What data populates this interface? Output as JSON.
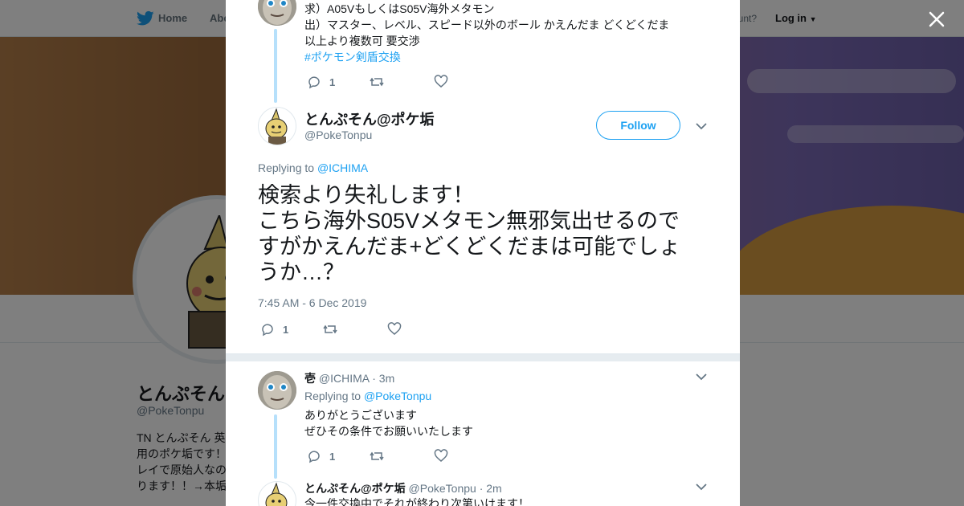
{
  "topnav": {
    "home_label": "Home",
    "about_label": "Abo",
    "account_question": "ccount?",
    "login_label": "Log in"
  },
  "profile": {
    "name": "とんぷそん",
    "handle": "@PokeTonpu",
    "bio": "TN とんぷそん 英\n用のポケ垢です！\nレイで原始人なの\nります！！→本垢"
  },
  "modal": {
    "prev_tweet": {
      "lines": [
        "求）A05VもしくはS05V海外メタモン",
        "出）マスター、レベル、スピード以外のボール かえんだま どくどくだま",
        "以上より複数可 要交渉"
      ],
      "hashtag": "#ポケモン剣盾交換",
      "reply_count": "1"
    },
    "main_tweet": {
      "display_name": "とんぷそん@ポケ垢",
      "handle": "@PokeTonpu",
      "follow_label": "Follow",
      "replying_prefix": "Replying to",
      "replying_to": "@ICHIMA",
      "text": "検索より失礼します！\nこちら海外S05Vメタモン無邪気出せるので\nすがかえんだま+どくどくだまは可能でしょ\nうか…？",
      "timestamp": "7:45 AM - 6 Dec 2019",
      "reply_count": "1"
    },
    "reply_1": {
      "display_name": "壱",
      "handle": "@ICHIMA",
      "time": "· 3m",
      "replying_prefix": "Replying to",
      "replying_to": "@PokeTonpu",
      "lines": [
        "ありがとうございます",
        "ぜひその条件でお願いいたします"
      ],
      "reply_count": "1"
    },
    "reply_2": {
      "display_name": "とんぷそん@ポケ垢",
      "handle": "@PokeTonpu",
      "time": "· 2m",
      "text": "今一件交換中でそれが終わり次第いけます！"
    }
  },
  "icons": {
    "bird": "twitter-bird-icon",
    "close": "close-icon",
    "reply": "reply-icon",
    "retweet": "retweet-icon",
    "like": "heart-icon",
    "caret": "chevron-down-icon"
  },
  "colors": {
    "accent": "#1da1f2",
    "text": "#14171a",
    "muted": "#657786",
    "thread_line": "#b6e0fb"
  }
}
